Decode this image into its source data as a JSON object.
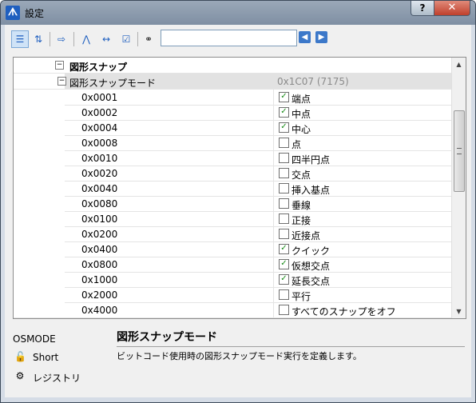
{
  "window": {
    "title": "設定",
    "app_icon": "autocad-logo-icon",
    "help_label": "?",
    "close_label": "✕"
  },
  "toolbar": {
    "icons": [
      "categorized-view-icon",
      "alphabetical-sort-icon",
      "export-icon",
      "app-logo-icon",
      "dimension-icon",
      "checklist-icon",
      "binoculars-icon",
      "back-arrow-icon",
      "forward-arrow-icon"
    ],
    "search_value": ""
  },
  "grid": {
    "category": {
      "label": "図形スナップ",
      "toggle": "−"
    },
    "sub": {
      "label": "図形スナップモード",
      "value": "0x1C07 (7175)",
      "toggle": "−"
    },
    "rows": [
      {
        "code": "0x0001",
        "checked": true,
        "label": "端点"
      },
      {
        "code": "0x0002",
        "checked": true,
        "label": "中点"
      },
      {
        "code": "0x0004",
        "checked": true,
        "label": "中心"
      },
      {
        "code": "0x0008",
        "checked": false,
        "label": "点"
      },
      {
        "code": "0x0010",
        "checked": false,
        "label": "四半円点"
      },
      {
        "code": "0x0020",
        "checked": false,
        "label": "交点"
      },
      {
        "code": "0x0040",
        "checked": false,
        "label": "挿入基点"
      },
      {
        "code": "0x0080",
        "checked": false,
        "label": "垂線"
      },
      {
        "code": "0x0100",
        "checked": false,
        "label": "正接"
      },
      {
        "code": "0x0200",
        "checked": false,
        "label": "近接点"
      },
      {
        "code": "0x0400",
        "checked": true,
        "label": "クイック"
      },
      {
        "code": "0x0800",
        "checked": true,
        "label": "仮想交点"
      },
      {
        "code": "0x1000",
        "checked": true,
        "label": "延長交点"
      },
      {
        "code": "0x2000",
        "checked": false,
        "label": "平行"
      },
      {
        "code": "0x4000",
        "checked": false,
        "label": "すべてのスナップをオフ"
      }
    ]
  },
  "bottom": {
    "variable_name": "OSMODE",
    "type_label": "Short",
    "storage_label": "レジストリ",
    "desc_title": "図形スナップモード",
    "desc_text": "ビットコード使用時の図形スナップモード実行を定義します。"
  }
}
